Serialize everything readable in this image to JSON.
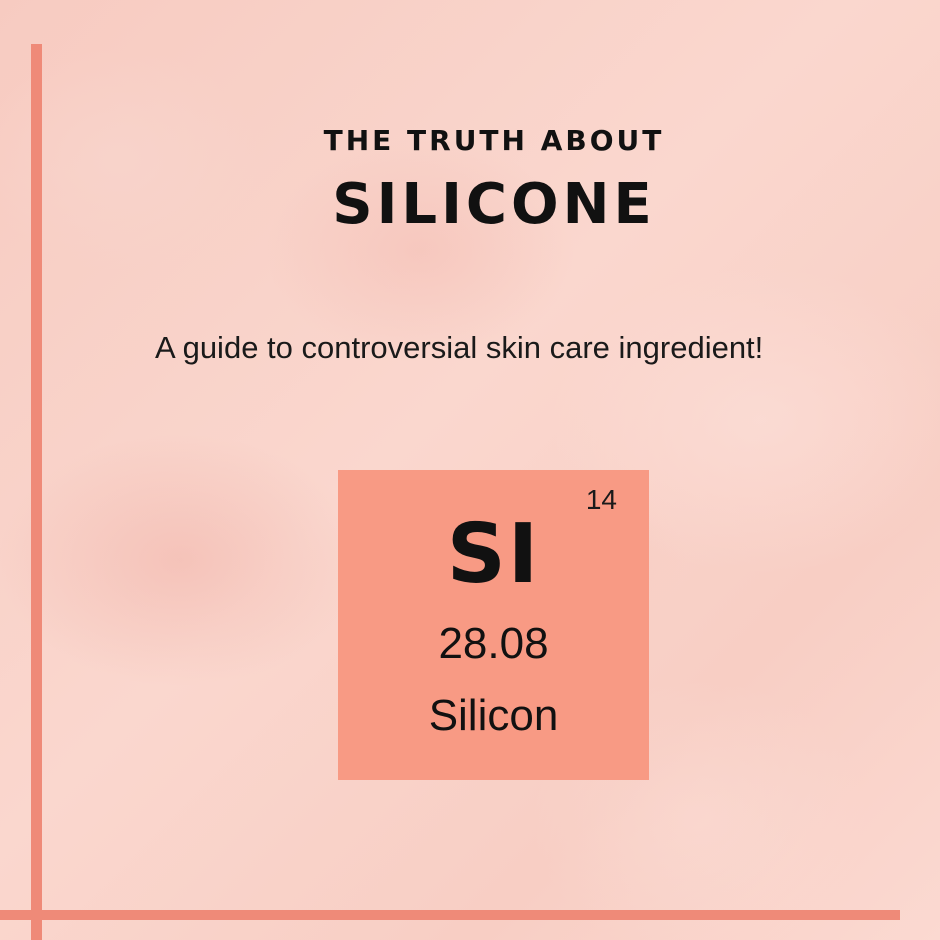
{
  "poster": {
    "kicker": "THE TRUTH ABOUT",
    "headline": "SILICONE",
    "subtitle": "A guide to controversial skin care ingredient!"
  },
  "element": {
    "atomic_number": "14",
    "symbol": "SI",
    "atomic_mass": "28.08",
    "name": "Silicon"
  },
  "colors": {
    "background": "#f9d2c8",
    "accent_line": "#ef8a78",
    "tile": "#f89a84",
    "text": "#111111"
  }
}
